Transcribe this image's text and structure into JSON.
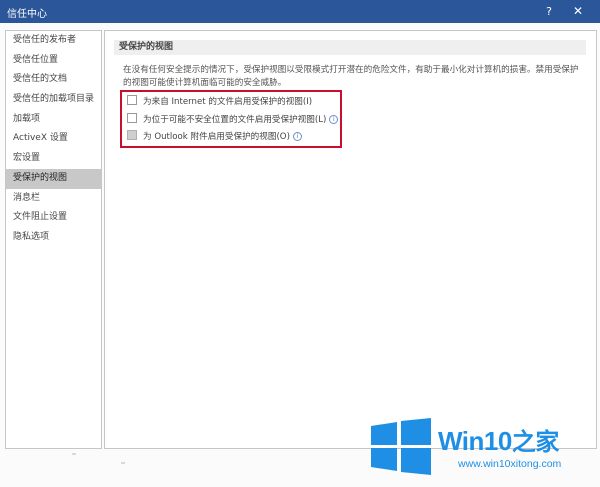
{
  "window": {
    "title": "信任中心",
    "help_label": "?",
    "close_label": "✕"
  },
  "sidebar": {
    "items": [
      {
        "label": "受信任的发布者"
      },
      {
        "label": "受信任位置"
      },
      {
        "label": "受信任的文档"
      },
      {
        "label": "受信任的加载项目录"
      },
      {
        "label": "加载项"
      },
      {
        "label": "ActiveX 设置"
      },
      {
        "label": "宏设置"
      },
      {
        "label": "受保护的视图",
        "active": true
      },
      {
        "label": "消息栏"
      },
      {
        "label": "文件阻止设置"
      },
      {
        "label": "隐私选项"
      }
    ]
  },
  "main": {
    "section_title": "受保护的视图",
    "description": "在没有任何安全提示的情况下，受保护视图以受限模式打开潜在的危险文件，有助于最小化对计算机的损害。禁用受保护的视图可能使计算机面临可能的安全威胁。",
    "options": [
      {
        "label": "为来自 Internet 的文件启用受保护的视图(I)",
        "checked": false,
        "enabled": true,
        "info": false
      },
      {
        "label": "为位于可能不安全位置的文件启用受保护视图(L)",
        "checked": false,
        "enabled": true,
        "info": true
      },
      {
        "label": "为 Outlook 附件启用受保护的视图(O)",
        "checked": false,
        "enabled": false,
        "info": true
      }
    ]
  },
  "watermark": {
    "brand": "Win10",
    "brand_cn": "之家",
    "url": "www.win10xitong.com",
    "colors": {
      "blue": "#1f8fe5"
    }
  },
  "colors": {
    "titlebar": "#2b579a",
    "highlight_box": "#c8102e",
    "active_item": "#c8c8c8"
  }
}
